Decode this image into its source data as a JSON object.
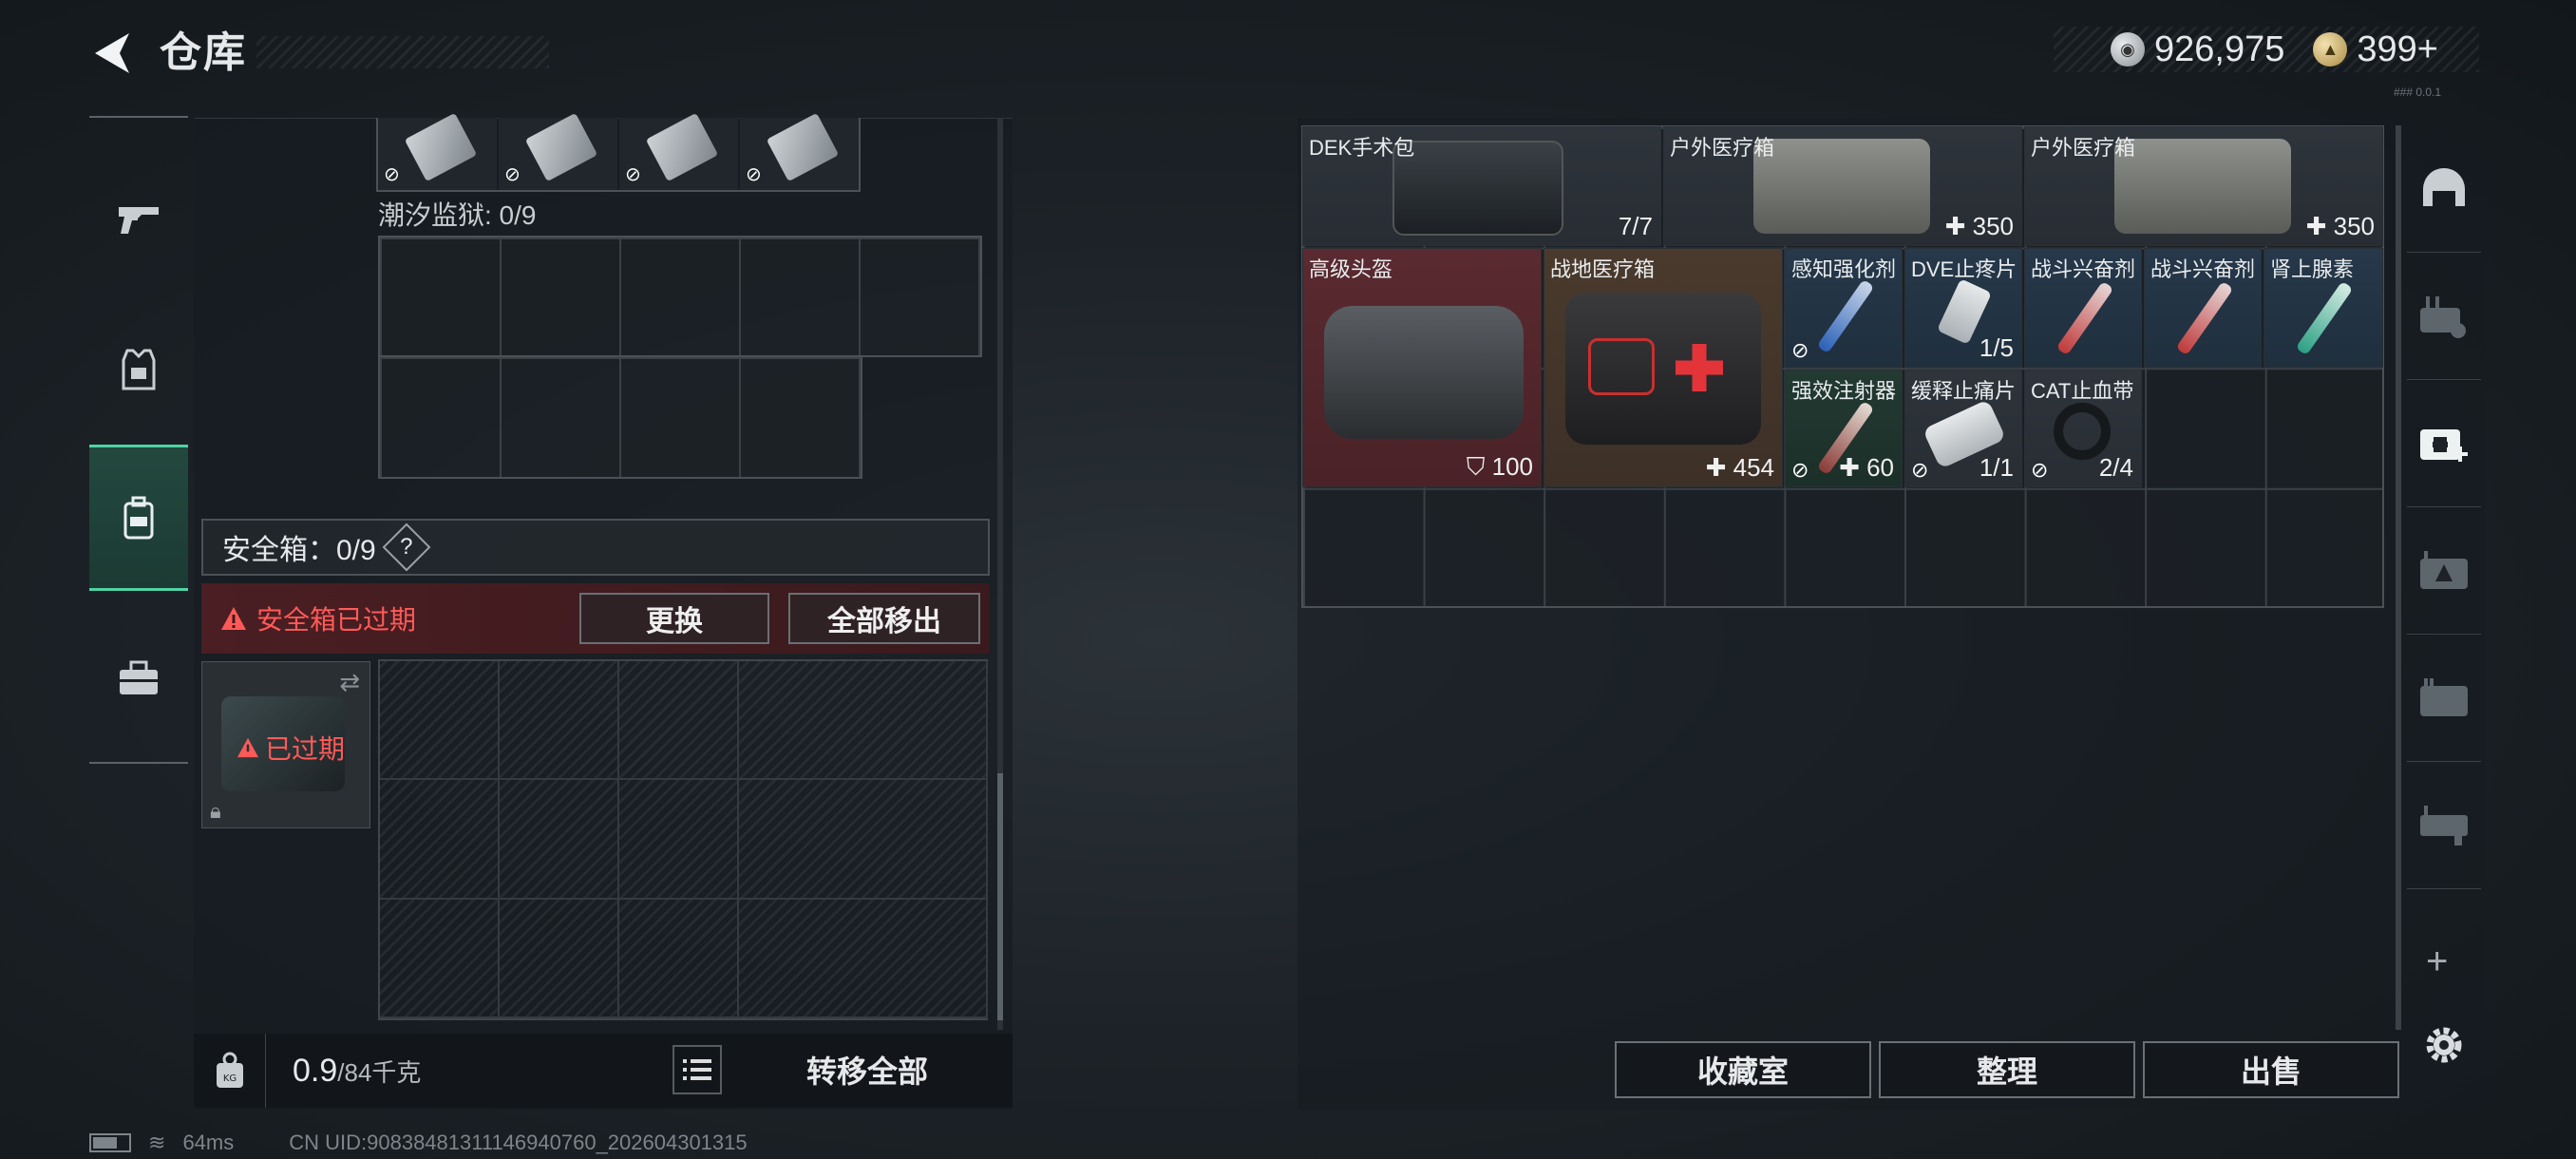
{
  "header": {
    "title": "仓库",
    "currency": [
      {
        "icon": "silver-coin-icon",
        "value": "926,975"
      },
      {
        "icon": "gold-coin-icon",
        "value": "399+"
      }
    ],
    "version": "### 0.0.1"
  },
  "left_nav": [
    "gun-icon",
    "armor-icon",
    "backpack-icon",
    "toolbox-icon"
  ],
  "left_panel": {
    "prison_label": "潮汐监狱: 0/9",
    "safe_box_label": "安全箱：0/9",
    "safe_help": "?",
    "expired_warning": "安全箱已过期",
    "replace_button": "更换",
    "remove_all_button": "全部移出",
    "safe_case_status": "已过期",
    "weight_current": "0.9",
    "weight_capacity": "/84千克",
    "transfer_all_button": "转移全部"
  },
  "items": [
    {
      "name": "DEK手术包",
      "value": "7/7"
    },
    {
      "name": "户外医疗箱",
      "value": "350"
    },
    {
      "name": "户外医疗箱",
      "value": "350"
    },
    {
      "name": "高级头盔",
      "value": "100"
    },
    {
      "name": "战地医疗箱",
      "value": "454"
    },
    {
      "name": "感知强化剂",
      "value": ""
    },
    {
      "name": "DVE止疼片",
      "value": "1/5"
    },
    {
      "name": "战斗兴奋剂",
      "value": ""
    },
    {
      "name": "战斗兴奋剂",
      "value": ""
    },
    {
      "name": "肾上腺素",
      "value": ""
    },
    {
      "name": "强效注射器",
      "value": "60"
    },
    {
      "name": "缓释止痛片",
      "value": "1/1"
    },
    {
      "name": "CAT止血带",
      "value": "2/4"
    }
  ],
  "actions": {
    "collection_room": "收藏室",
    "organize": "整理",
    "sell": "出售",
    "add": "+"
  },
  "status_bar": {
    "ping": "64ms",
    "uid": "CN UID:9083848131114694076​0_202604301315"
  },
  "colors": {
    "accent_green": "#4fd3a5",
    "warning_red": "#ff5a58"
  }
}
